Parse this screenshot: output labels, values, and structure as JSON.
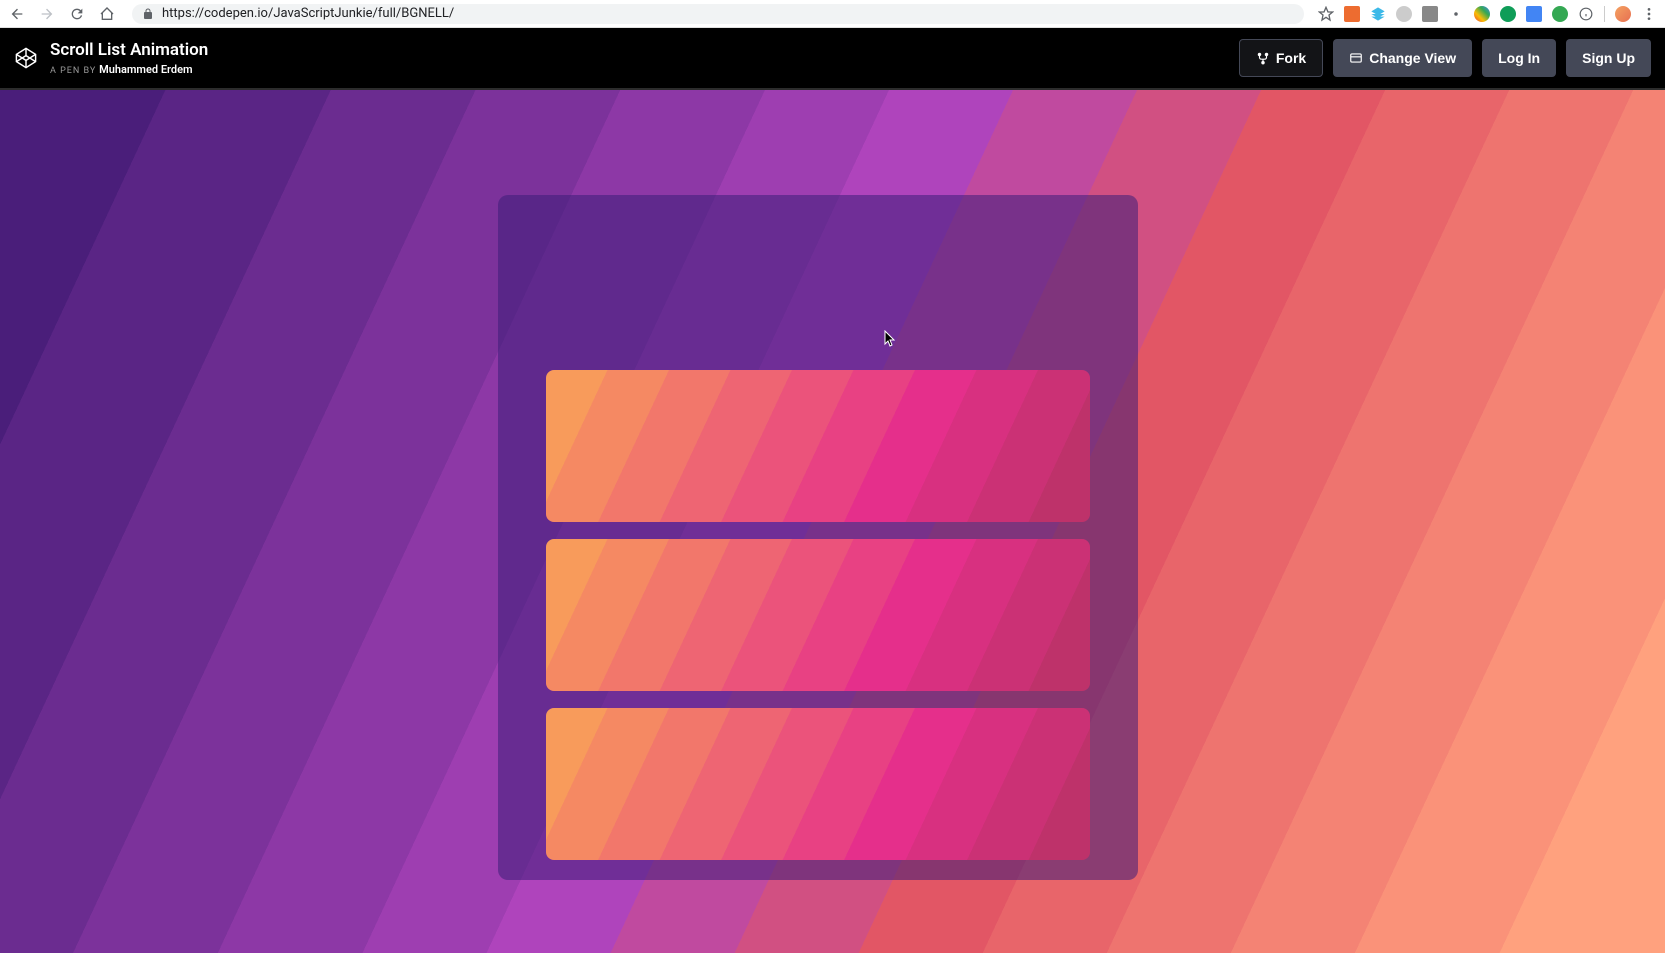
{
  "browser": {
    "url": "https://codepen.io/JavaScriptJunkie/full/BGNELL/"
  },
  "codepen": {
    "pen_title": "Scroll List Animation",
    "byline_prefix": "A Pen By",
    "author": "Muhammed Erdem",
    "buttons": {
      "fork": "Fork",
      "change_view": "Change View",
      "log_in": "Log In",
      "sign_up": "Sign Up"
    }
  }
}
